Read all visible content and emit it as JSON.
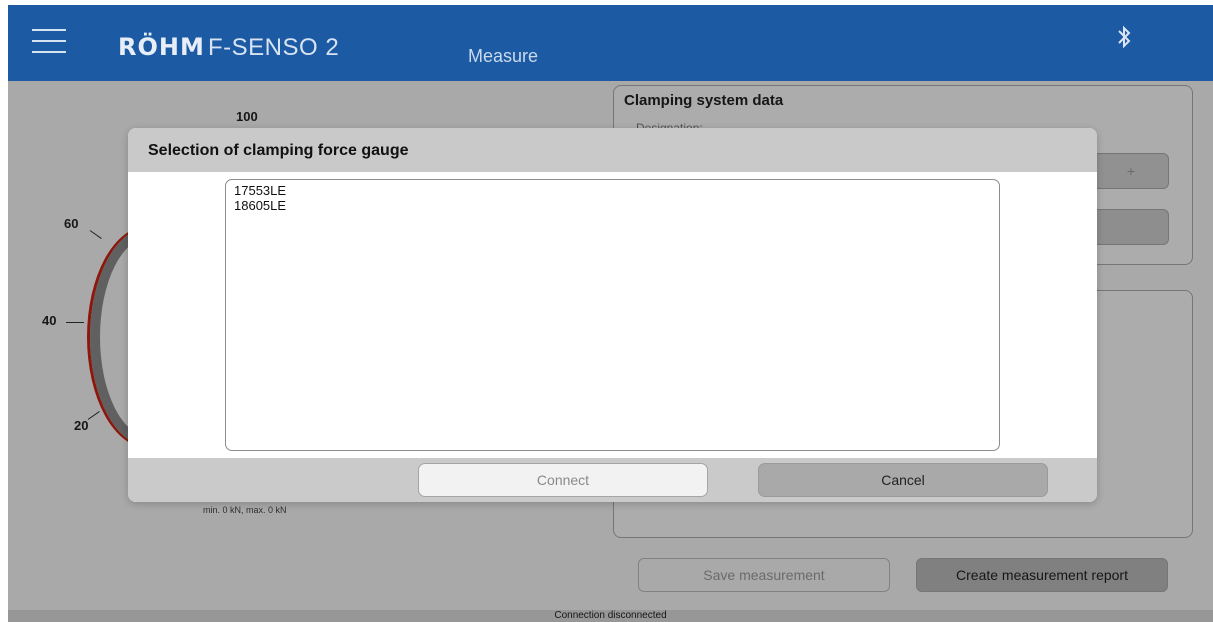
{
  "header": {
    "logo": "RÖHM",
    "product": "F-SENSO 2",
    "tab_label": "Measure",
    "bluetooth_icon": "bluetooth-icon"
  },
  "gauge": {
    "ticks": [
      "100",
      "60",
      "40",
      "20"
    ],
    "min_max": "min. 0 kN, max. 0 kN"
  },
  "clamping_panel": {
    "title": "Clamping system data",
    "designation_label": "Designation:"
  },
  "buttons": {
    "save": "Save measurement",
    "report": "Create measurement report"
  },
  "status": "Connection disconnected",
  "dialog": {
    "title": "Selection of clamping force gauge",
    "items": [
      "17553LE",
      "18605LE"
    ],
    "connect": "Connect",
    "cancel": "Cancel"
  },
  "colors": {
    "header_bg": "#1c5aa3",
    "dialog_header_bg": "#c9c9c9",
    "gauge_red": "#c21111"
  }
}
